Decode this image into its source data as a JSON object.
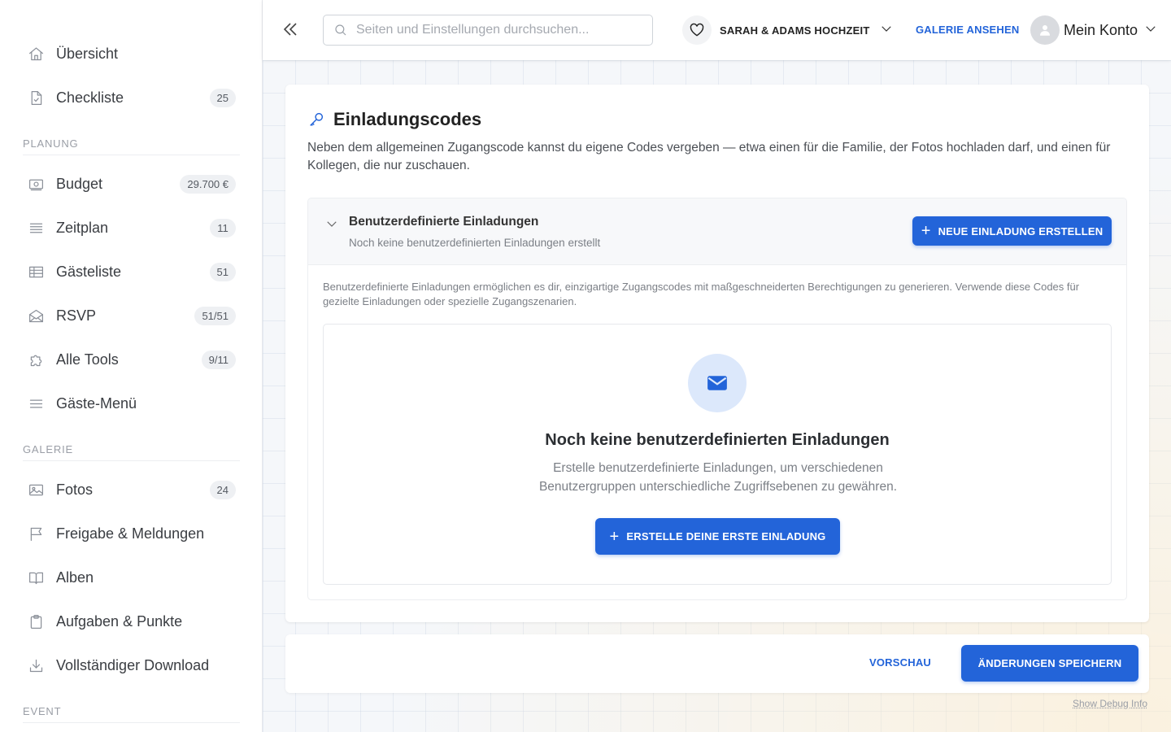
{
  "sidebar": {
    "top_items": [
      {
        "label": "Übersicht",
        "badge": "",
        "icon": "home-icon"
      },
      {
        "label": "Checkliste",
        "badge": "25",
        "icon": "checklist-icon"
      }
    ],
    "sections": [
      {
        "label": "PLANUNG",
        "items": [
          {
            "label": "Budget",
            "badge": "29.700 €",
            "icon": "money-icon"
          },
          {
            "label": "Zeitplan",
            "badge": "11",
            "icon": "timeline-icon"
          },
          {
            "label": "Gästeliste",
            "badge": "51",
            "icon": "table-icon"
          },
          {
            "label": "RSVP",
            "badge": "51/51",
            "icon": "envelope-open-icon"
          },
          {
            "label": "Alle Tools",
            "badge": "9/11",
            "icon": "puzzle-icon"
          },
          {
            "label": "Gäste-Menü",
            "badge": "",
            "icon": "menu-icon"
          }
        ]
      },
      {
        "label": "GALERIE",
        "items": [
          {
            "label": "Fotos",
            "badge": "24",
            "icon": "image-icon"
          },
          {
            "label": "Freigabe & Meldungen",
            "badge": "",
            "icon": "flag-icon"
          },
          {
            "label": "Alben",
            "badge": "",
            "icon": "book-icon"
          },
          {
            "label": "Aufgaben & Punkte",
            "badge": "",
            "icon": "clipboard-icon"
          },
          {
            "label": "Vollständiger Download",
            "badge": "",
            "icon": "download-icon"
          }
        ]
      },
      {
        "label": "EVENT",
        "items": []
      }
    ]
  },
  "header": {
    "search_placeholder": "Seiten und Einstellungen durchsuchen...",
    "event_name": "SARAH & ADAMS HOCHZEIT",
    "gallery_link": "GALERIE ANSEHEN",
    "account_label": "Mein Konto"
  },
  "card": {
    "title": "Einladungscodes",
    "description": "Neben dem allgemeinen Zugangscode kannst du eigene Codes vergeben — etwa einen für die Familie, der Fotos hochladen darf, und einen für Kollegen, die nur zuschauen.",
    "panel": {
      "title": "Benutzerdefinierte Einladungen",
      "subtitle": "Noch keine benutzerdefinierten Einladungen erstellt",
      "new_button": "NEUE EINLADUNG ERSTELLEN",
      "info": "Benutzerdefinierte Einladungen ermöglichen es dir, einzigartige Zugangscodes mit maßgeschneiderten Berechtigungen zu generieren. Verwende diese Codes für gezielte Einladungen oder spezielle Zugangszenarien.",
      "empty_title": "Noch keine benutzerdefinierten Einladungen",
      "empty_text": "Erstelle benutzerdefinierte Einladungen, um verschiedenen Benutzergruppen unterschiedliche Zugriffsebenen zu gewähren.",
      "first_button": "ERSTELLE DEINE ERSTE EINLADUNG"
    }
  },
  "footer": {
    "preview_label": "VORSCHAU",
    "save_label": "ÄNDERUNGEN SPEICHERN",
    "debug_label": "Show Debug Info"
  },
  "colors": {
    "accent": "#2364d9",
    "accent_light": "#dce8fb"
  }
}
